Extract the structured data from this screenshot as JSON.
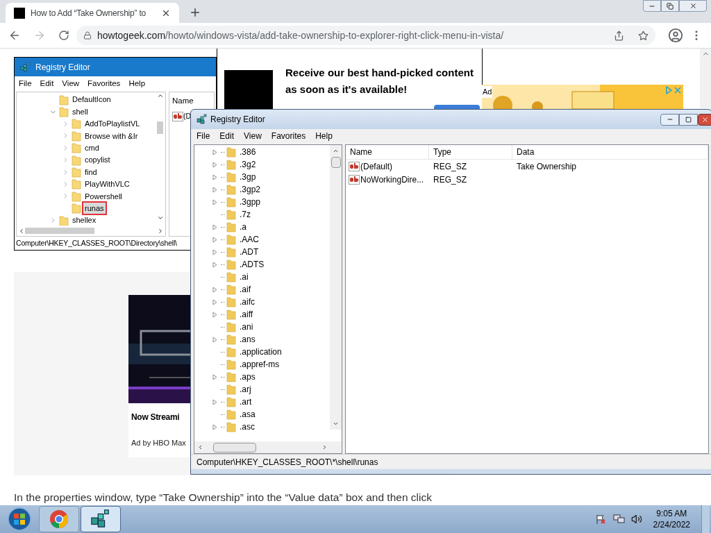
{
  "browser": {
    "tab": {
      "title": "How to Add “Take Ownership” to",
      "selected": true
    },
    "address": {
      "domain": "howtogeek.com",
      "path": "/howto/windows-vista/add-take-ownership-to-explorer-right-click-menu-in-vista/"
    }
  },
  "article_image": {
    "title": "Registry Editor",
    "menu": [
      "File",
      "Edit",
      "View",
      "Favorites",
      "Help"
    ],
    "tree": [
      {
        "label": "DefaultIcon",
        "expandable": false,
        "expanded": false,
        "selected": false
      },
      {
        "label": "shell",
        "expandable": true,
        "expanded": true,
        "selected": false,
        "children": [
          {
            "label": "AddToPlaylistVL",
            "expandable": true,
            "expanded": false,
            "selected": false
          },
          {
            "label": "Browse with &Ir",
            "expandable": true,
            "expanded": false,
            "selected": false
          },
          {
            "label": "cmd",
            "expandable": true,
            "expanded": false,
            "selected": false
          },
          {
            "label": "copylist",
            "expandable": true,
            "expanded": false,
            "selected": false
          },
          {
            "label": "find",
            "expandable": true,
            "expanded": false,
            "selected": false
          },
          {
            "label": "PlayWithVLC",
            "expandable": true,
            "expanded": false,
            "selected": false
          },
          {
            "label": "Powershell",
            "expandable": true,
            "expanded": false,
            "selected": false
          },
          {
            "label": "runas",
            "expandable": false,
            "expanded": false,
            "selected": true
          }
        ]
      },
      {
        "label": "shellex",
        "expandable": true,
        "expanded": false,
        "selected": false
      }
    ],
    "column": "Name",
    "row_name": "(D",
    "status": "Computer\\HKEY_CLASSES_ROOT\\Directory\\shell\\"
  },
  "notification": {
    "heading": "Receive our best hand-picked content as soon as it's available!",
    "buttons": [
      {
        "kind": "primary"
      }
    ]
  },
  "banner_ad": {
    "badge": "Ad"
  },
  "ad_card": {
    "heading": "Now Streami",
    "sponsor": "Ad by HBO Max"
  },
  "paragraph": "In the properties window, type “Take Ownership” into the “Value data” box and then click",
  "regedit": {
    "title": "Registry Editor",
    "menu": [
      "File",
      "Edit",
      "View",
      "Favorites",
      "Help"
    ],
    "tree": [
      {
        "label": ".386",
        "expandable": true
      },
      {
        "label": ".3g2",
        "expandable": true
      },
      {
        "label": ".3gp",
        "expandable": true
      },
      {
        "label": ".3gp2",
        "expandable": true
      },
      {
        "label": ".3gpp",
        "expandable": true
      },
      {
        "label": ".7z",
        "expandable": false
      },
      {
        "label": ".a",
        "expandable": true
      },
      {
        "label": ".AAC",
        "expandable": true
      },
      {
        "label": ".ADT",
        "expandable": true
      },
      {
        "label": ".ADTS",
        "expandable": true
      },
      {
        "label": ".ai",
        "expandable": false
      },
      {
        "label": ".aif",
        "expandable": true
      },
      {
        "label": ".aifc",
        "expandable": true
      },
      {
        "label": ".aiff",
        "expandable": true
      },
      {
        "label": ".ani",
        "expandable": false
      },
      {
        "label": ".ans",
        "expandable": true
      },
      {
        "label": ".application",
        "expandable": false
      },
      {
        "label": ".appref-ms",
        "expandable": false
      },
      {
        "label": ".aps",
        "expandable": true
      },
      {
        "label": ".arj",
        "expandable": false
      },
      {
        "label": ".art",
        "expandable": true
      },
      {
        "label": ".asa",
        "expandable": false
      },
      {
        "label": ".asc",
        "expandable": true
      }
    ],
    "columns": [
      "Name",
      "Type",
      "Data"
    ],
    "rows": [
      {
        "name": "(Default)",
        "type": "REG_SZ",
        "data": "Take Ownership"
      },
      {
        "name": "NoWorkingDire...",
        "type": "REG_SZ"
      }
    ],
    "status": "Computer\\HKEY_CLASSES_ROOT\\*\\shell\\runas"
  },
  "taskbar": {
    "apps": [
      {
        "kind": "chrome",
        "selected": false
      },
      {
        "kind": "regedit",
        "selected": true
      }
    ],
    "time": "9:05 AM",
    "date": "2/24/2022"
  }
}
